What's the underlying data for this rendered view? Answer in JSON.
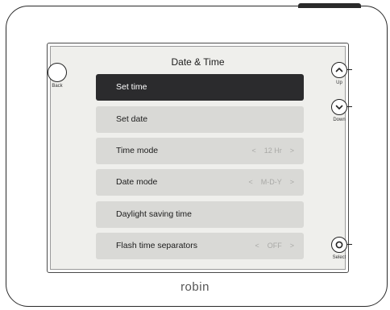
{
  "screen": {
    "title": "Date & Time"
  },
  "side_buttons": {
    "back": "Back",
    "up": "Up",
    "down": "Down",
    "select": "Select"
  },
  "menu": {
    "items": [
      {
        "label": "Set time",
        "selected": true
      },
      {
        "label": "Set date"
      },
      {
        "label": "Time mode",
        "value": "12 Hr",
        "prev_glyph": "<",
        "next_glyph": ">"
      },
      {
        "label": "Date mode",
        "value": "M-D-Y",
        "prev_glyph": "<",
        "next_glyph": ">"
      },
      {
        "label": "Daylight saving time"
      },
      {
        "label": "Flash time separators",
        "value": "OFF",
        "prev_glyph": "<",
        "next_glyph": ">"
      }
    ]
  },
  "brand": {
    "logo_text": "robin"
  },
  "colors": {
    "selected_bg": "#2b2b2d",
    "item_bg": "#d9d9d6",
    "screen_bg": "#efefec"
  }
}
